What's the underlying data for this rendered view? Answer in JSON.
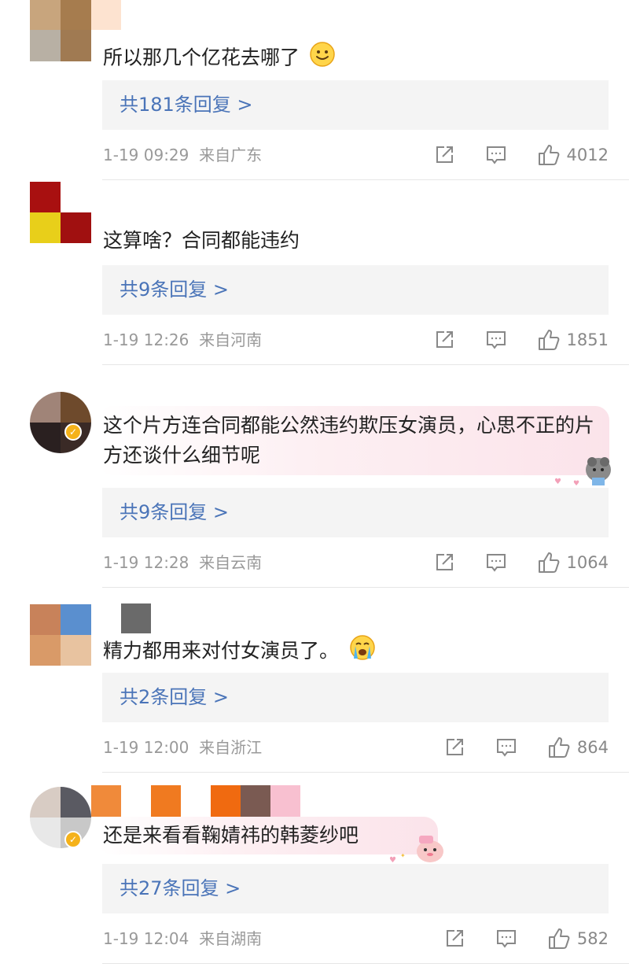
{
  "comments": [
    {
      "text": "所以那几个亿花去哪了",
      "emoji": "smile-emoji",
      "replies": "共181条回复 >",
      "date": "1-19 09:29",
      "location": "来自广东",
      "likes": "4012"
    },
    {
      "text": "这算啥？合同都能违约",
      "replies": "共9条回复 >",
      "date": "1-19 12:26",
      "location": "来自河南",
      "likes": "1851"
    },
    {
      "text": "这个片方连合同都能公然违约欺压女演员，心思不正的片方还谈什么细节呢",
      "replies": "共9条回复 >",
      "date": "1-19 12:28",
      "location": "来自云南",
      "likes": "1064"
    },
    {
      "text": "精力都用来对付女演员了。",
      "emoji": "crying-emoji",
      "replies": "共2条回复 >",
      "date": "1-19 12:00",
      "location": "来自浙江",
      "likes": "864"
    },
    {
      "text": "还是来看看鞠婧祎的韩菱纱吧",
      "replies": "共27条回复 >",
      "date": "1-19 12:04",
      "location": "来自湖南",
      "likes": "582"
    }
  ],
  "colors": {
    "reply_link": "#4a74b8",
    "meta_gray": "#999999",
    "reply_bg": "#f4f4f4",
    "verified_badge": "#f5b21a"
  }
}
